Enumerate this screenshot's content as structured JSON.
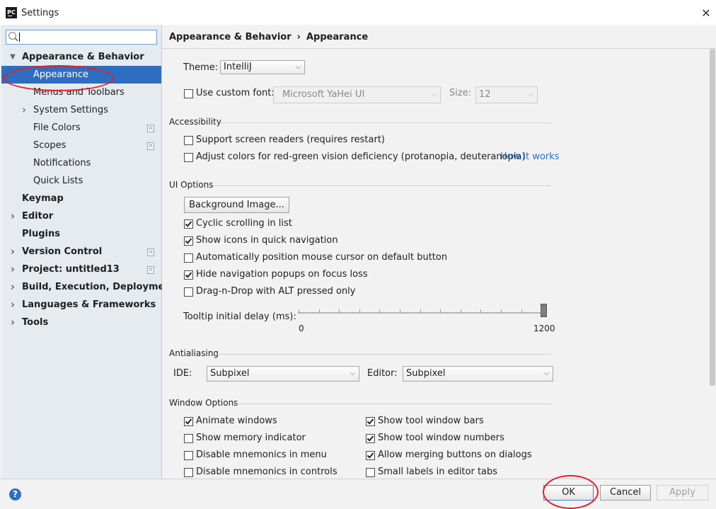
{
  "window": {
    "title": "Settings",
    "app_icon": "PC",
    "close_glyph": "✕"
  },
  "sidebar": {
    "search_value": "",
    "items": [
      {
        "label": "Appearance & Behavior",
        "bold": true,
        "arrow": "expanded",
        "level": 0
      },
      {
        "label": "Appearance",
        "selected": true,
        "level": 1
      },
      {
        "label": "Menus and Toolbars",
        "level": 1
      },
      {
        "label": "System Settings",
        "arrow": "collapsed",
        "level": 1
      },
      {
        "label": "File Colors",
        "level": 1,
        "page_icon": true
      },
      {
        "label": "Scopes",
        "level": 1,
        "page_icon": true
      },
      {
        "label": "Notifications",
        "level": 1
      },
      {
        "label": "Quick Lists",
        "level": 1
      },
      {
        "label": "Keymap",
        "bold": true,
        "level": 0
      },
      {
        "label": "Editor",
        "bold": true,
        "arrow": "collapsed",
        "level": 0
      },
      {
        "label": "Plugins",
        "bold": true,
        "level": 0
      },
      {
        "label": "Version Control",
        "bold": true,
        "arrow": "collapsed",
        "level": 0,
        "page_icon": true
      },
      {
        "label": "Project: untitled13",
        "bold": true,
        "arrow": "collapsed",
        "level": 0,
        "page_icon": true
      },
      {
        "label": "Build, Execution, Deployment",
        "bold": true,
        "arrow": "collapsed",
        "level": 0
      },
      {
        "label": "Languages & Frameworks",
        "bold": true,
        "arrow": "collapsed",
        "level": 0
      },
      {
        "label": "Tools",
        "bold": true,
        "arrow": "collapsed",
        "level": 0
      }
    ]
  },
  "breadcrumb": {
    "parent": "Appearance & Behavior",
    "sep": "›",
    "current": "Appearance"
  },
  "theme": {
    "label": "Theme:",
    "value": "IntelliJ"
  },
  "custom_font": {
    "label": "Use custom font:",
    "checked": false,
    "font_value": "Microsoft YaHei UI",
    "size_label": "Size:",
    "size_value": "12"
  },
  "accessibility": {
    "title": "Accessibility",
    "screen_readers": {
      "label": "Support screen readers (requires restart)",
      "checked": false
    },
    "adjust_colors": {
      "label": "Adjust colors for red-green vision deficiency (protanopia, deuteranopia)",
      "checked": false
    },
    "how_it_works": "How it works"
  },
  "ui_options": {
    "title": "UI Options",
    "background_button": "Background Image...",
    "checks": [
      {
        "label": "Cyclic scrolling in list",
        "checked": true
      },
      {
        "label": "Show icons in quick navigation",
        "checked": true
      },
      {
        "label": "Automatically position mouse cursor on default button",
        "checked": false
      },
      {
        "label": "Hide navigation popups on focus loss",
        "checked": true
      },
      {
        "label": "Drag-n-Drop with ALT pressed only",
        "checked": false
      }
    ],
    "tooltip_label": "Tooltip initial delay (ms):",
    "tooltip_min": "0",
    "tooltip_max": "1200",
    "tooltip_value": 1200
  },
  "antialiasing": {
    "title": "Antialiasing",
    "ide_label": "IDE:",
    "ide_value": "Subpixel",
    "editor_label": "Editor:",
    "editor_value": "Subpixel"
  },
  "window_options": {
    "title": "Window Options",
    "left": [
      {
        "label": "Animate windows",
        "checked": true
      },
      {
        "label": "Show memory indicator",
        "checked": false
      },
      {
        "label": "Disable mnemonics in menu",
        "checked": false
      },
      {
        "label": "Disable mnemonics in controls",
        "checked": false
      }
    ],
    "right": [
      {
        "label": "Show tool window bars",
        "checked": true
      },
      {
        "label": "Show tool window numbers",
        "checked": true
      },
      {
        "label": "Allow merging buttons on dialogs",
        "checked": true
      },
      {
        "label": "Small labels in editor tabs",
        "checked": false
      }
    ]
  },
  "buttons": {
    "help": "?",
    "ok": "OK",
    "cancel": "Cancel",
    "apply": "Apply"
  },
  "colors": {
    "selection": "#2f6dc0",
    "sidebar_bg": "#e6ebf0",
    "link": "#2470c4",
    "annotation": "#e0202a"
  }
}
